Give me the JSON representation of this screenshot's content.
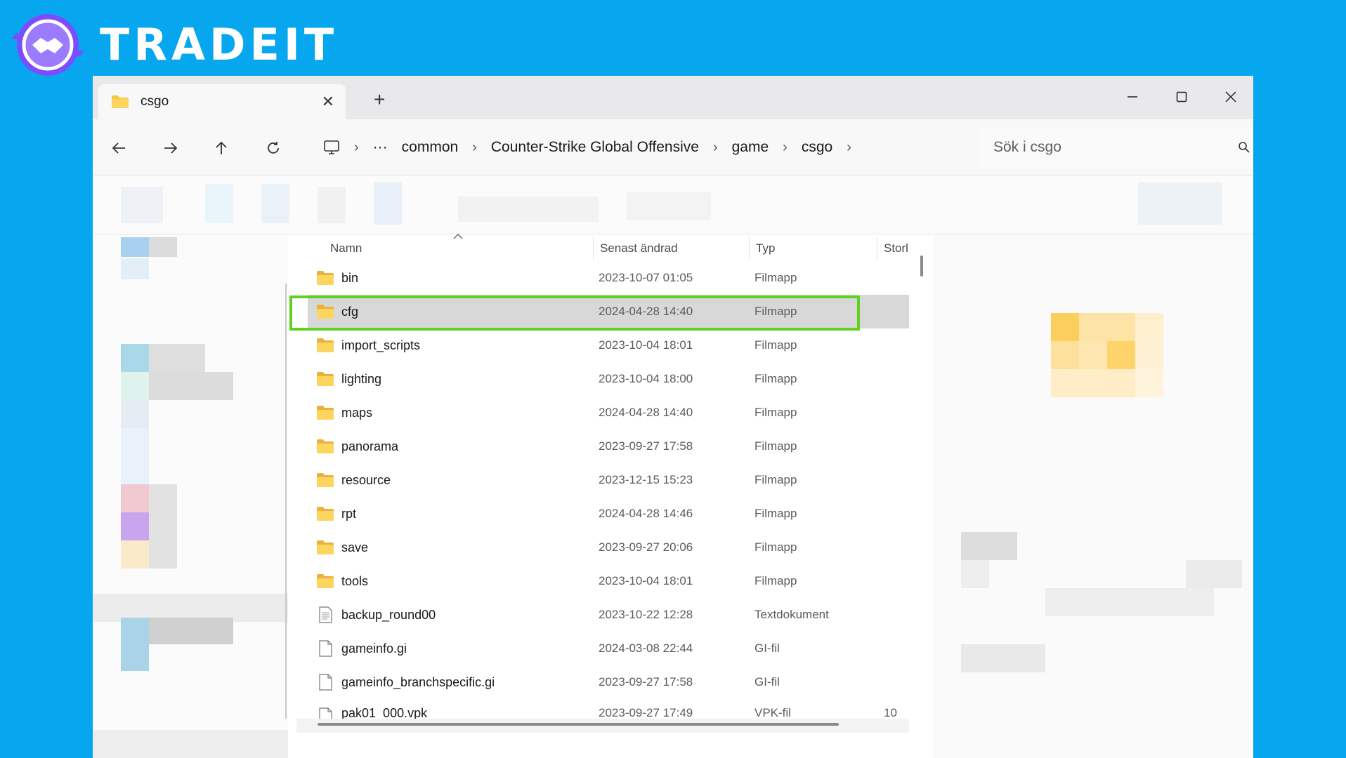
{
  "logo": {
    "text": "TRADEIT"
  },
  "window": {
    "tab": {
      "title": "csgo",
      "close": "✕"
    },
    "new_tab": "+",
    "controls": {
      "minimize": "—",
      "maximize": "☐",
      "close": "✕"
    }
  },
  "nav": {
    "more": "···",
    "breadcrumbs": [
      "common",
      "Counter-Strike Global Offensive",
      "game",
      "csgo"
    ],
    "search_placeholder": "Sök i csgo"
  },
  "columns": {
    "name": "Namn",
    "modified": "Senast ändrad",
    "type": "Typ",
    "size": "Storl"
  },
  "files": [
    {
      "name": "bin",
      "modified": "2023-10-07 01:05",
      "type": "Filmapp",
      "size": "",
      "kind": "folder"
    },
    {
      "name": "cfg",
      "modified": "2024-04-28 14:40",
      "type": "Filmapp",
      "size": "",
      "kind": "folder",
      "selected": true
    },
    {
      "name": "import_scripts",
      "modified": "2023-10-04 18:01",
      "type": "Filmapp",
      "size": "",
      "kind": "folder"
    },
    {
      "name": "lighting",
      "modified": "2023-10-04 18:00",
      "type": "Filmapp",
      "size": "",
      "kind": "folder"
    },
    {
      "name": "maps",
      "modified": "2024-04-28 14:40",
      "type": "Filmapp",
      "size": "",
      "kind": "folder"
    },
    {
      "name": "panorama",
      "modified": "2023-09-27 17:58",
      "type": "Filmapp",
      "size": "",
      "kind": "folder"
    },
    {
      "name": "resource",
      "modified": "2023-12-15 15:23",
      "type": "Filmapp",
      "size": "",
      "kind": "folder"
    },
    {
      "name": "rpt",
      "modified": "2024-04-28 14:46",
      "type": "Filmapp",
      "size": "",
      "kind": "folder"
    },
    {
      "name": "save",
      "modified": "2023-09-27 20:06",
      "type": "Filmapp",
      "size": "",
      "kind": "folder"
    },
    {
      "name": "tools",
      "modified": "2023-10-04 18:01",
      "type": "Filmapp",
      "size": "",
      "kind": "folder"
    },
    {
      "name": "backup_round00",
      "modified": "2023-10-22 12:28",
      "type": "Textdokument",
      "size": "",
      "kind": "text"
    },
    {
      "name": "gameinfo.gi",
      "modified": "2024-03-08 22:44",
      "type": "GI-fil",
      "size": "",
      "kind": "file"
    },
    {
      "name": "gameinfo_branchspecific.gi",
      "modified": "2023-09-27 17:58",
      "type": "GI-fil",
      "size": "",
      "kind": "file"
    },
    {
      "name": "pak01_000.vpk",
      "modified": "2023-09-27 17:49",
      "type": "VPK-fil",
      "size": "10",
      "kind": "file"
    }
  ],
  "colors": {
    "background": "#06a7ef",
    "highlight": "#5fd11f",
    "folder": "#f7c948"
  }
}
